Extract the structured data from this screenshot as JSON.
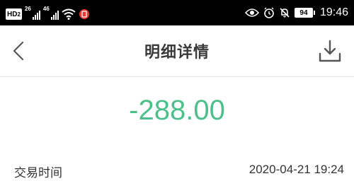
{
  "status_bar": {
    "hd_label": "HD",
    "hd_sub": "2",
    "sim1_label": "26",
    "sim2_label": "46",
    "battery_level": "94",
    "time": "19:46",
    "icons": [
      "hd-icon",
      "signal-icon",
      "signal-icon",
      "wifi-icon",
      "nfc-icon",
      "eye-icon",
      "alarm-icon",
      "mute-bell-icon",
      "battery-icon"
    ]
  },
  "nav": {
    "title": "明细详情",
    "back_icon": "chevron-left-icon",
    "download_icon": "download-icon"
  },
  "transaction": {
    "amount": "-288.00",
    "amount_color": "#4cbf8a",
    "time_label": "交易时间",
    "time_value": "2020-04-21 19:24"
  }
}
